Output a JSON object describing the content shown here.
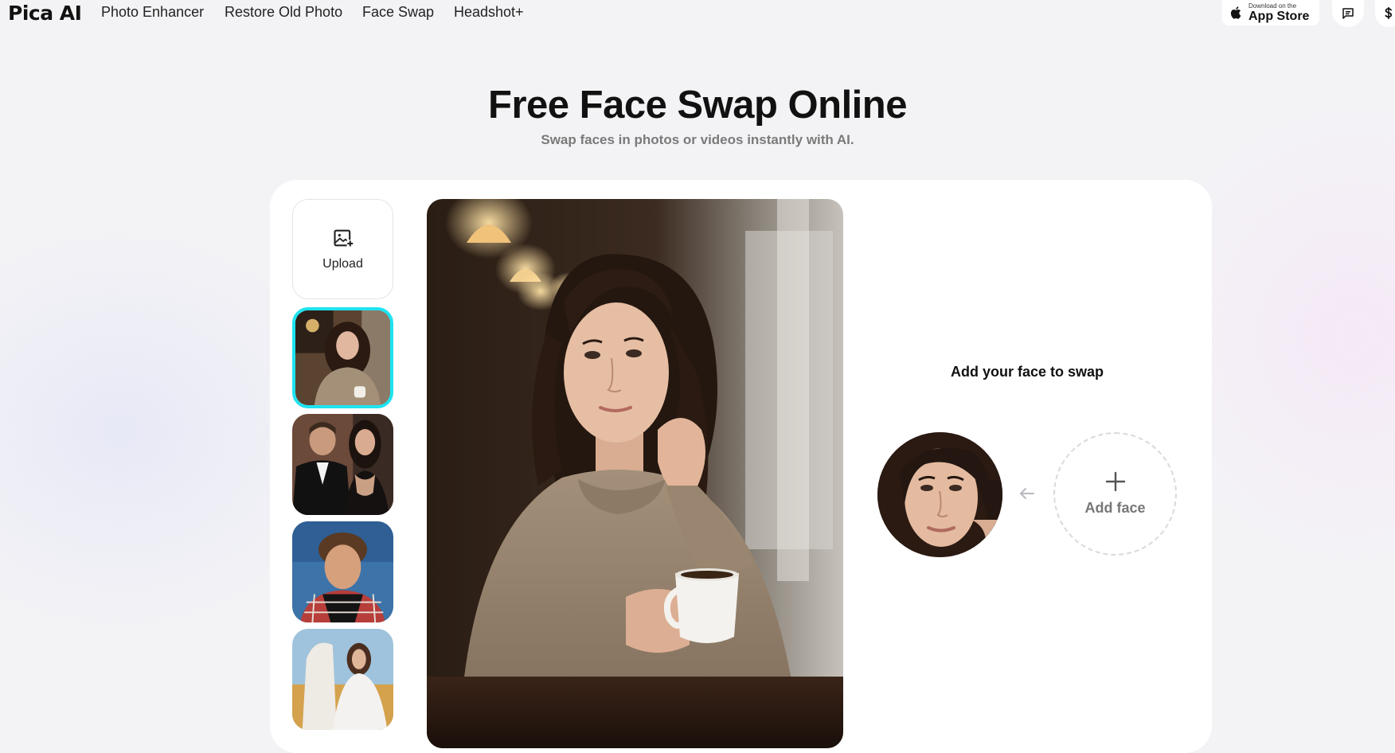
{
  "header": {
    "logo": "Pica AI",
    "nav": [
      "Photo Enhancer",
      "Restore Old Photo",
      "Face Swap",
      "Headshot+"
    ],
    "app_store": {
      "small": "Download on the",
      "big": "App Store"
    },
    "icons": [
      "apple-icon",
      "message-icon",
      "currency-icon"
    ]
  },
  "hero": {
    "title": "Free Face Swap Online",
    "subtitle": "Swap faces in photos or videos instantly with AI."
  },
  "sidebar": {
    "upload_label": "Upload",
    "thumbnails": [
      "woman-cafe",
      "couple-formal",
      "teen-boy-plaid",
      "woman-horse"
    ],
    "selected_index": 0
  },
  "swap_panel": {
    "title": "Add your face to swap",
    "add_face_label": "Add face"
  },
  "colors": {
    "accent_selected": "#1ee3f0",
    "card_bg": "#ffffff",
    "page_bg": "#f3f3f6"
  }
}
